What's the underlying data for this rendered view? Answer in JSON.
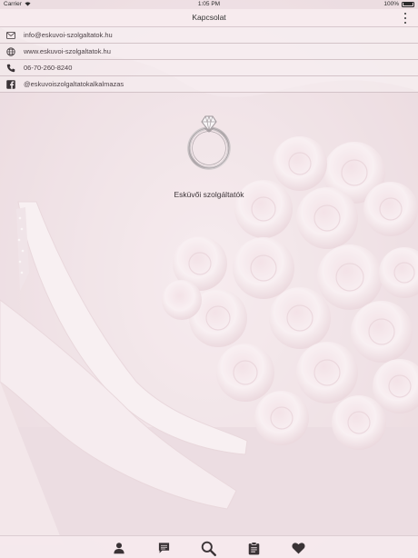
{
  "status_bar": {
    "carrier": "Carrier",
    "time": "1:05 PM",
    "battery": "100%",
    "battery_level": 1.0
  },
  "nav": {
    "title": "Kapcsolat",
    "menu_icon": "more-vertical-icon"
  },
  "contacts": [
    {
      "icon": "mail-icon",
      "text": "info@eskuvoi-szolgaltatok.hu"
    },
    {
      "icon": "globe-icon",
      "text": "www.eskuvoi-szolgaltatok.hu"
    },
    {
      "icon": "phone-icon",
      "text": "06-70-260-8240"
    },
    {
      "icon": "facebook-icon",
      "text": "@eskuvoiszolgaltatokalkalmazas"
    }
  ],
  "logo": {
    "icon": "diamond-ring-icon",
    "text": "Esküvői szolgáltatók"
  },
  "tab_bar": {
    "tabs": [
      {
        "icon": "person-icon"
      },
      {
        "icon": "chat-icon"
      },
      {
        "icon": "search-icon"
      },
      {
        "icon": "clipboard-icon"
      },
      {
        "icon": "heart-icon"
      }
    ]
  },
  "colors": {
    "background": "#f1e6e9",
    "icon": "#3a3336",
    "accent": "#d9b9c2"
  }
}
